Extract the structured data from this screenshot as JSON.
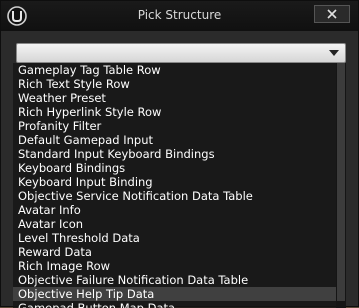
{
  "window": {
    "title": "Pick Structure"
  },
  "combo": {
    "value": ""
  },
  "list": {
    "items": [
      "Gameplay Tag Table Row",
      "Rich Text Style Row",
      "Weather Preset",
      "Rich Hyperlink Style Row",
      "Profanity Filter",
      "Default Gamepad Input",
      "Standard Input Keyboard Bindings",
      "Keyboard Bindings",
      "Keyboard Input Binding",
      "Objective Service Notification Data Table",
      "Avatar Info",
      "Avatar Icon",
      "Level Threshold Data",
      "Reward Data",
      "Rich Image Row",
      "Objective Failure Notification Data Table",
      "Objective Help Tip Data",
      "Gamepad Button Map Data"
    ],
    "selected_index": 16
  },
  "icons": {
    "logo": "unreal-engine-logo-icon",
    "close": "close-icon",
    "dropdown": "chevron-down-icon"
  }
}
